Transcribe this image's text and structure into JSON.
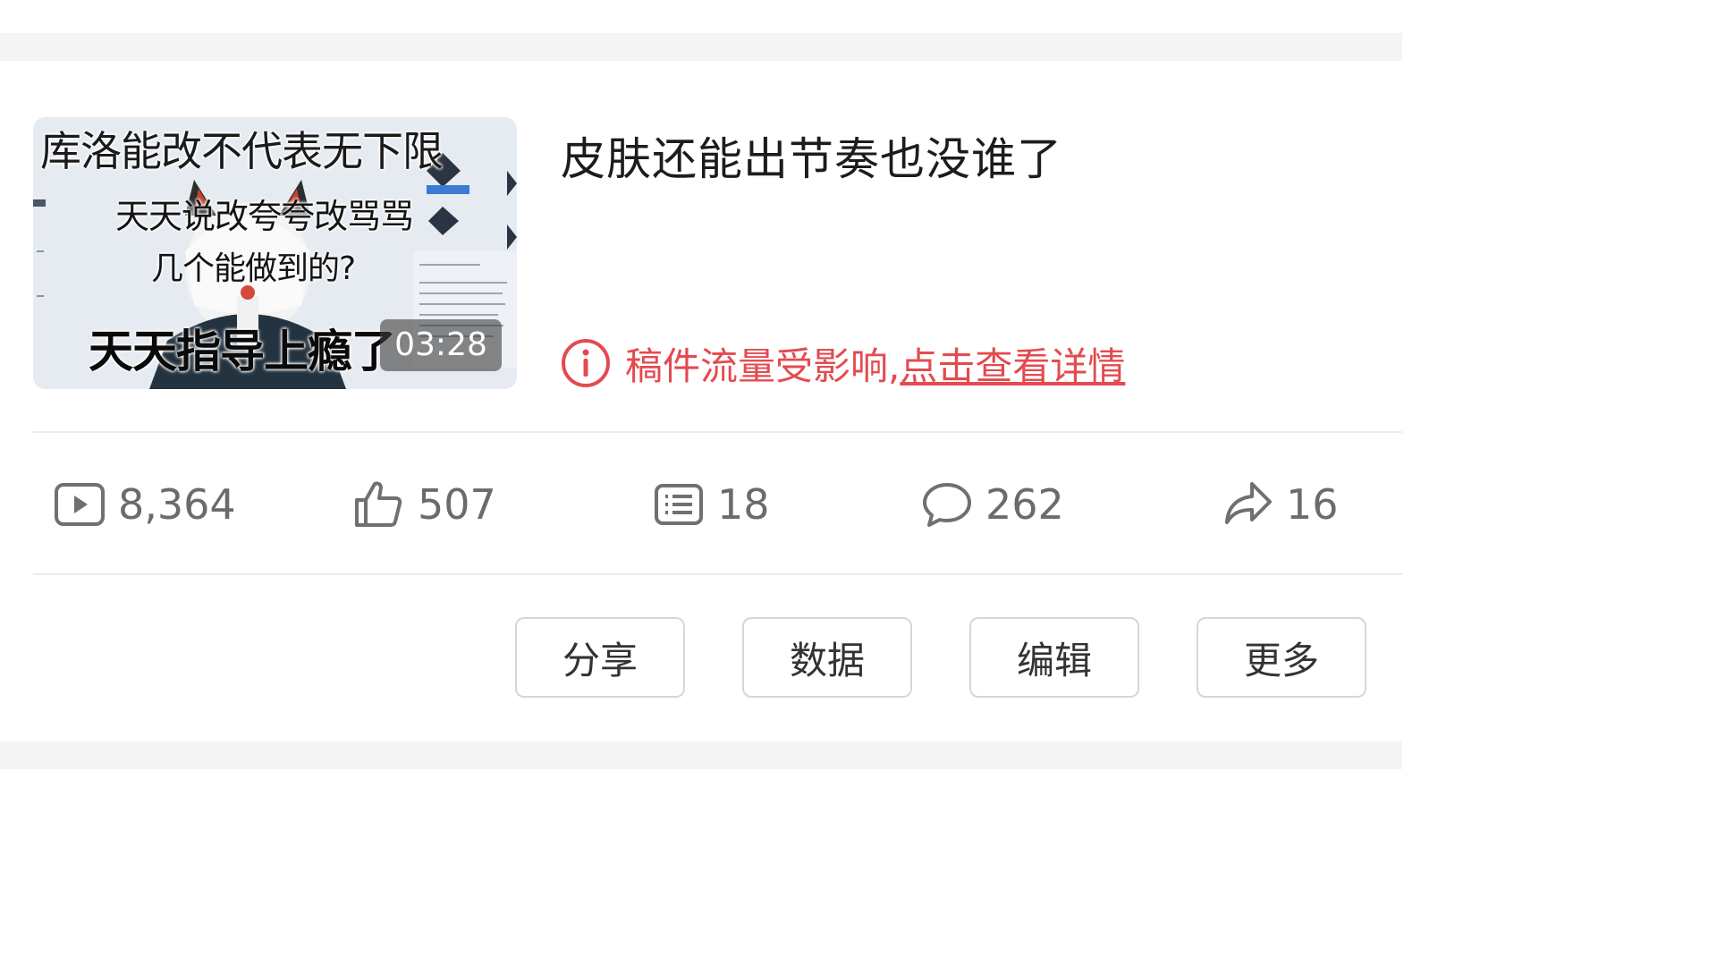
{
  "video": {
    "thumbnail": {
      "caption_top": "库洛能改不代表无下限",
      "caption_middle": "天天说改夸夸改骂骂",
      "caption_middle2": "几个能做到的?",
      "caption_bottom": "天天指导上瘾了",
      "duration": "03:28"
    },
    "title": "皮肤还能出节奏也没谁了",
    "warning": {
      "icon": "info-circle-icon",
      "text": "稿件流量受影响,",
      "link": "点击查看详情",
      "color": "#e34b50"
    }
  },
  "stats": [
    {
      "icon": "play-icon",
      "value": "8,364"
    },
    {
      "icon": "thumbs-up-icon",
      "value": "507"
    },
    {
      "icon": "danmaku-icon",
      "value": "18"
    },
    {
      "icon": "comment-icon",
      "value": "262"
    },
    {
      "icon": "share-icon",
      "value": "16"
    }
  ],
  "actions": {
    "share": "分享",
    "data": "数据",
    "edit": "编辑",
    "more": "更多"
  }
}
